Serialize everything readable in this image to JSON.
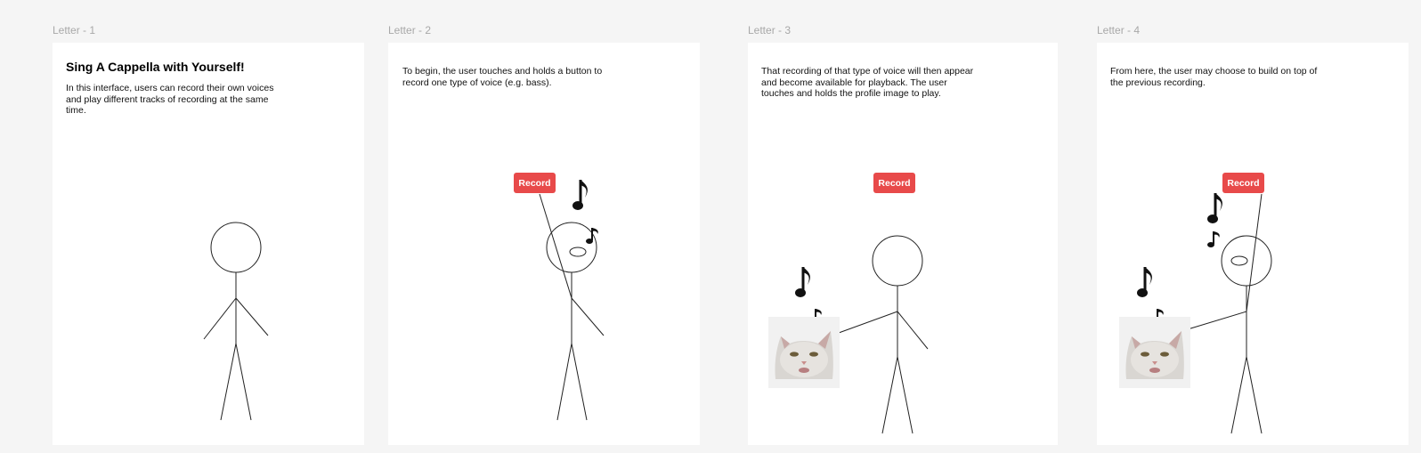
{
  "frames": [
    {
      "label": "Letter - 1",
      "heading": "Sing A Cappella with Yourself!",
      "text": "In this interface, users can record their own voices and play different tracks of recording at the same time."
    },
    {
      "label": "Letter - 2",
      "text": "To begin, the user touches and holds a button to record one type of voice (e.g. bass).",
      "record_label": "Record"
    },
    {
      "label": "Letter - 3",
      "text": "That recording of that type of voice will then appear and become available for playback. The user touches and holds the profile image to play.",
      "record_label": "Record"
    },
    {
      "label": "Letter - 4",
      "text": "From here, the user may choose to build on top of the previous recording.",
      "record_label": "Record"
    }
  ],
  "colors": {
    "canvas": "#f5f5f5",
    "frame": "#ffffff",
    "record_button": "#e84a4a",
    "label": "#a8a8a8"
  },
  "icons": [
    "music-note-icon",
    "cat-avatar-icon"
  ]
}
